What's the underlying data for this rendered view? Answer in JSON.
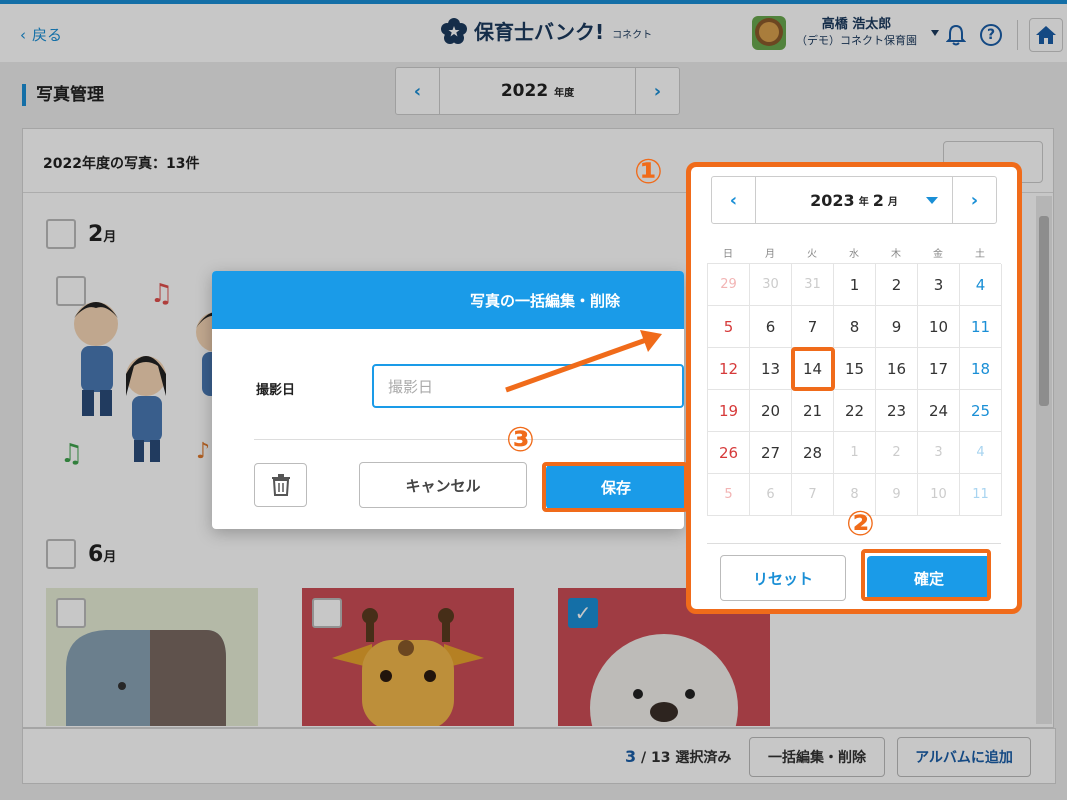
{
  "header": {
    "back_label": "戻る",
    "logo_text": "保育士バンク!",
    "logo_sub": "コネクト",
    "user_name": "高橋 浩太郎",
    "user_org": "（デモ）コネクト保育園",
    "help_glyph": "?"
  },
  "page": {
    "title": "写真管理",
    "year_value": "2022",
    "year_unit": "年度"
  },
  "panel": {
    "count_label": "2022年度の写真：13件",
    "sections": [
      {
        "month": "2",
        "unit": "月"
      },
      {
        "month": "6",
        "unit": "月"
      }
    ]
  },
  "footer": {
    "selected": "3",
    "total": "/ 13 選択済み",
    "bulk_edit_label": "一括編集・削除",
    "add_album_label": "アルバムに追加"
  },
  "modal": {
    "title": "写真の一括編集・削除",
    "date_label": "撮影日",
    "date_placeholder": "撮影日",
    "cancel_label": "キャンセル",
    "save_label": "保存"
  },
  "calendar": {
    "year": "2023",
    "year_unit": "年",
    "month": "2",
    "month_unit": "月",
    "weekdays": [
      "日",
      "月",
      "火",
      "水",
      "木",
      "金",
      "土"
    ],
    "days": [
      [
        "29",
        "30",
        "31",
        "1",
        "2",
        "3",
        "4"
      ],
      [
        "5",
        "6",
        "7",
        "8",
        "9",
        "10",
        "11"
      ],
      [
        "12",
        "13",
        "14",
        "15",
        "16",
        "17",
        "18"
      ],
      [
        "19",
        "20",
        "21",
        "22",
        "23",
        "24",
        "25"
      ],
      [
        "26",
        "27",
        "28",
        "1",
        "2",
        "3",
        "4"
      ],
      [
        "5",
        "6",
        "7",
        "8",
        "9",
        "10",
        "11"
      ]
    ],
    "selected_day": "14",
    "reset_label": "リセット",
    "confirm_label": "確定"
  },
  "annotations": {
    "step1": "①",
    "step2": "②",
    "step3": "③"
  },
  "colors": {
    "accent": "#1a9be8",
    "highlight": "#f06b1a",
    "sunday": "#d63a3a",
    "saturday": "#1a8fd6"
  }
}
